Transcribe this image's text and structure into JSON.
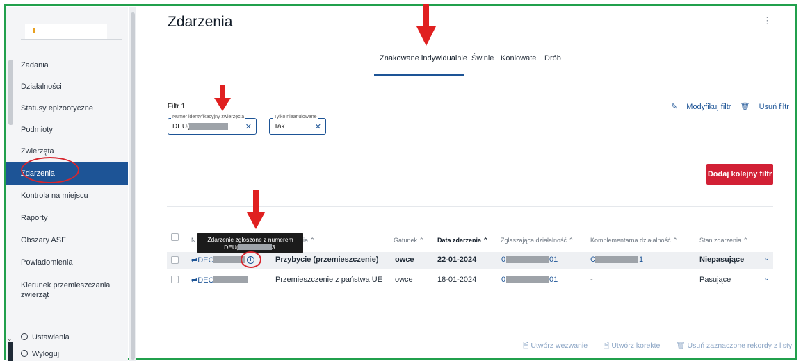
{
  "sidebar": {
    "items": [
      {
        "label": "Zadania"
      },
      {
        "label": "Działalności"
      },
      {
        "label": "Statusy epizootyczne"
      },
      {
        "label": "Podmioty"
      },
      {
        "label": "Zwierzęta"
      },
      {
        "label": "Zdarzenia"
      },
      {
        "label": "Kontrola na miejscu"
      },
      {
        "label": "Raporty"
      },
      {
        "label": "Obszary ASF"
      },
      {
        "label": "Powiadomienia"
      },
      {
        "label": "Kierunek przemieszczania zwierząt"
      }
    ],
    "settings": "Ustawienia",
    "logout": "Wyloguj"
  },
  "header": {
    "title": "Zdarzenia"
  },
  "tabs": [
    "Znakowane indywidualnie",
    "Świnie",
    "Koniowate",
    "Drób"
  ],
  "filter": {
    "label": "Filtr 1",
    "modify": "Modyfikuj filtr",
    "remove": "Usuń filtr",
    "chips": [
      {
        "legend": "Numer identyfikacyjny zwierzęcia",
        "value": "DEU("
      },
      {
        "legend": "Tylko nieanulowane",
        "value": "Tak"
      }
    ],
    "add_button": "Dodaj kolejny filtr"
  },
  "table": {
    "headers": {
      "number": "N",
      "type": "ia",
      "species": "Gatunek",
      "date": "Data zdarzenia",
      "reporting": "Zgłaszająca działalność",
      "complementary": "Komplementarna działalność",
      "status": "Stan zdarzenia"
    },
    "rows": [
      {
        "id": "DEC",
        "type": "Przybycie (przemieszczenie)",
        "species": "owce",
        "date": "22-01-2024",
        "reporting": "0",
        "reporting_tail": "01",
        "complementary": "C",
        "complementary_tail": "1",
        "status": "Niepasujące"
      },
      {
        "id": "DEC",
        "type": "Przemieszczenie z państwa UE",
        "species": "owce",
        "date": "18-01-2024",
        "reporting": "0",
        "reporting_tail": "01",
        "complementary": "-",
        "complementary_tail": "",
        "status": "Pasujące"
      }
    ]
  },
  "tooltip": {
    "line1": "Zdarzenie zgłoszone z numerem",
    "line2": "DEU(",
    "line2_tail": "3."
  },
  "bottom_actions": [
    "Utwórz wezwanie",
    "Utwórz korektę",
    "Usuń zaznaczone rekordy z listy"
  ],
  "colors": {
    "primary": "#1d5496",
    "accent_red": "#d22035",
    "annotation": "#d7262e",
    "frame": "#21a04c"
  }
}
